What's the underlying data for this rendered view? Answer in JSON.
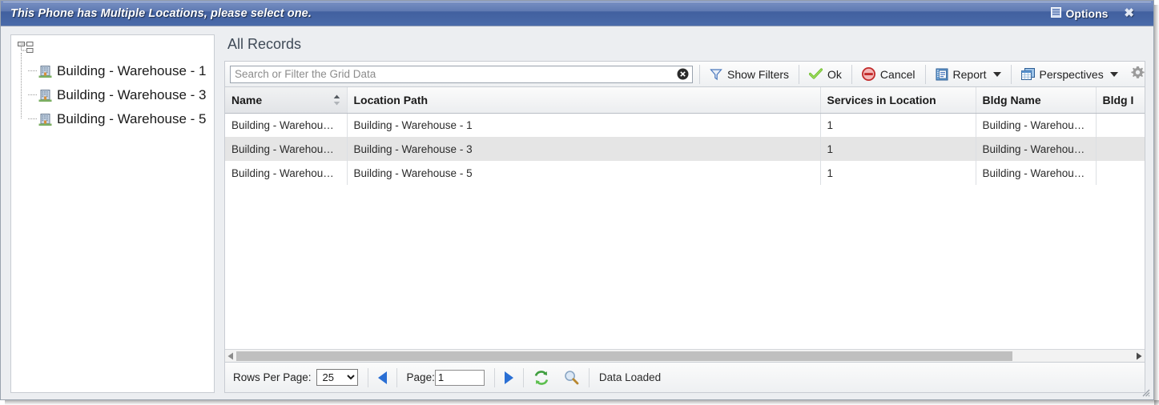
{
  "window": {
    "title": "This Phone has Multiple Locations, please select one.",
    "options_label": "Options",
    "options_icon": "grid-list-icon",
    "close_label": "✖",
    "accent_color": "#4a6aa9"
  },
  "tree": {
    "root_icon": "sitemap-icon",
    "items": [
      {
        "label": "Building - Warehouse - 1",
        "icon": "building-icon"
      },
      {
        "label": "Building - Warehouse - 3",
        "icon": "building-icon"
      },
      {
        "label": "Building - Warehouse - 5",
        "icon": "building-icon"
      }
    ]
  },
  "grid": {
    "heading": "All Records",
    "toolbar": {
      "search_placeholder": "Search or Filter the Grid Data",
      "search_value": "",
      "clear_icon": "clear-circle-icon",
      "show_filters_label": "Show Filters",
      "filter_icon": "funnel-icon",
      "ok_label": "Ok",
      "ok_icon": "green-check-icon",
      "cancel_label": "Cancel",
      "cancel_icon": "red-no-entry-icon",
      "report_label": "Report",
      "report_icon": "report-book-icon",
      "perspectives_label": "Perspectives",
      "perspectives_icon": "windows-stack-icon",
      "settings_icon": "gear-icon"
    },
    "columns": [
      {
        "label": "Name",
        "sorted": true,
        "sort_icon": "sort-both-icon"
      },
      {
        "label": "Location Path",
        "sorted": false
      },
      {
        "label": "Services in Location",
        "sorted": false
      },
      {
        "label": "Bldg Name",
        "sorted": false
      },
      {
        "label": "Bldg I",
        "sorted": false
      }
    ],
    "rows": [
      {
        "name": "Building - Warehou…",
        "location_path": "Building - Warehouse - 1",
        "services_in_location": "1",
        "bldg_name": "Building - Warehou…",
        "bldg_id": ""
      },
      {
        "name": "Building - Warehou…",
        "location_path": "Building - Warehouse - 3",
        "services_in_location": "1",
        "bldg_name": "Building - Warehou…",
        "bldg_id": ""
      },
      {
        "name": "Building - Warehou…",
        "location_path": "Building - Warehouse - 5",
        "services_in_location": "1",
        "bldg_name": "Building - Warehou…",
        "bldg_id": ""
      }
    ],
    "pager": {
      "rows_per_page_label": "Rows Per Page:",
      "rows_per_page_value": "25",
      "rows_per_page_options": [
        "25"
      ],
      "prev_icon": "prev-page-icon",
      "page_label": "Page:",
      "page_value": "1",
      "next_icon": "next-page-icon",
      "refresh_icon": "refresh-icon",
      "search_icon": "magnifier-icon",
      "status": "Data Loaded"
    }
  }
}
